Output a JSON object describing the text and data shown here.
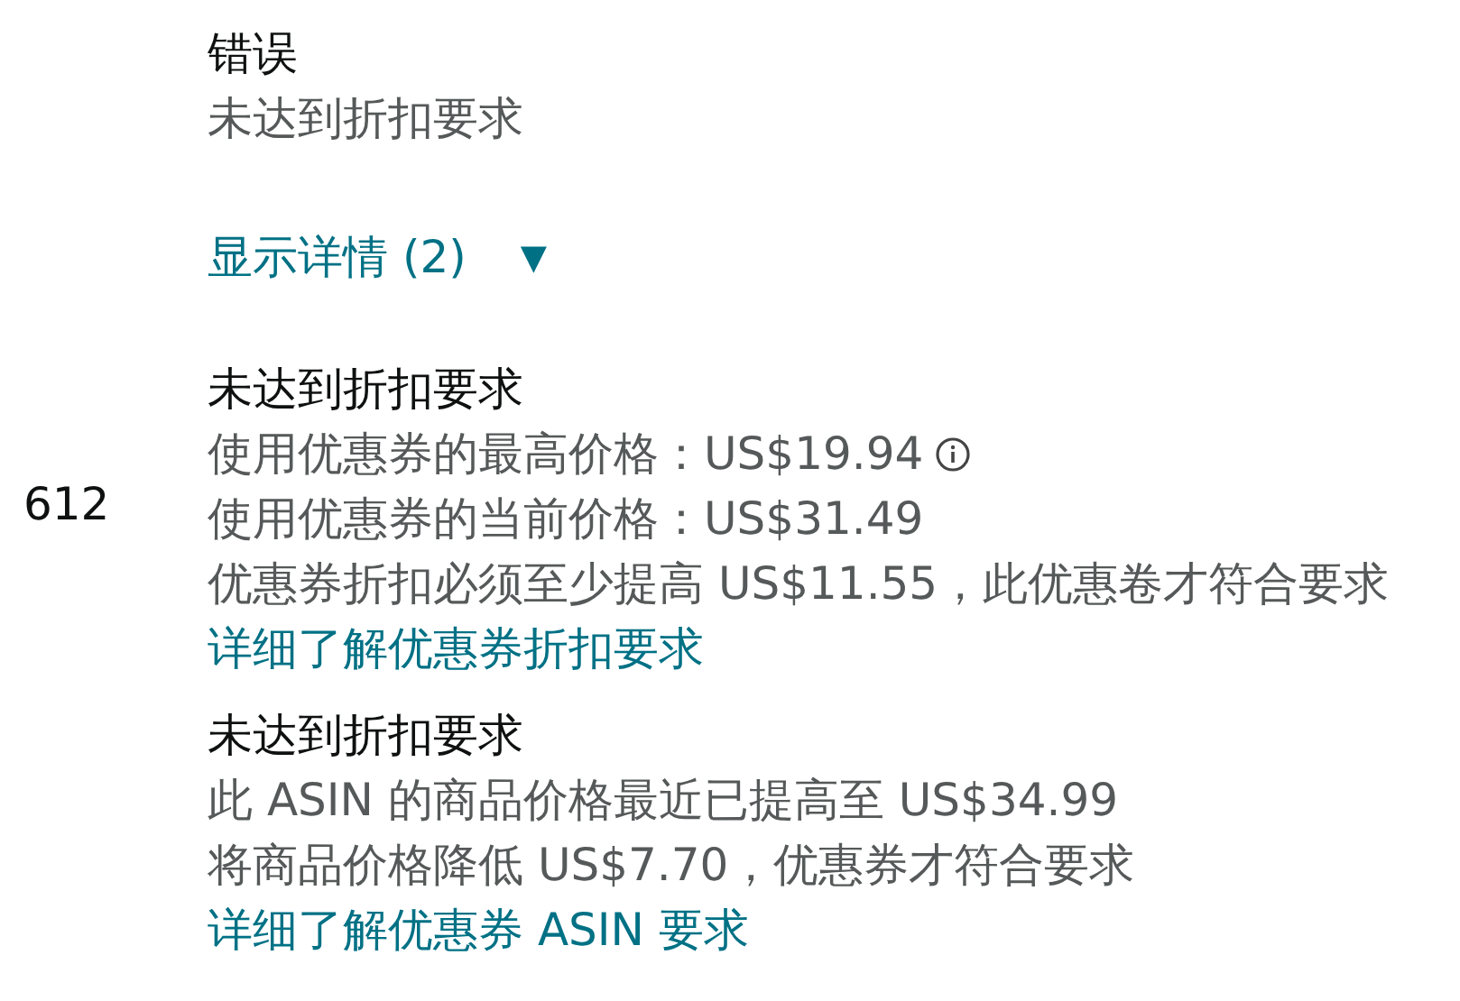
{
  "error": {
    "title": "错误",
    "message": "未达到折扣要求"
  },
  "details_toggle": {
    "label": "显示详情 (2)",
    "icon": "▼"
  },
  "row_number": "612",
  "issues": [
    {
      "title": "未达到折扣要求",
      "lines": [
        {
          "text": "使用优惠券的最高价格：US$19.94",
          "info": true
        },
        {
          "text": "使用优惠券的当前价格：US$31.49",
          "info": false
        },
        {
          "text": "优惠券折扣必须至少提高 US$11.55，此优惠卷才符合要求",
          "info": false
        }
      ],
      "link": "详细了解优惠券折扣要求"
    },
    {
      "title": "未达到折扣要求",
      "lines": [
        {
          "text": "此 ASIN 的商品价格最近已提高至 US$34.99",
          "info": false
        },
        {
          "text": "将商品价格降低 US$7.70，优惠券才符合要求",
          "info": false
        }
      ],
      "link": "详细了解优惠券 ASIN 要求"
    }
  ]
}
